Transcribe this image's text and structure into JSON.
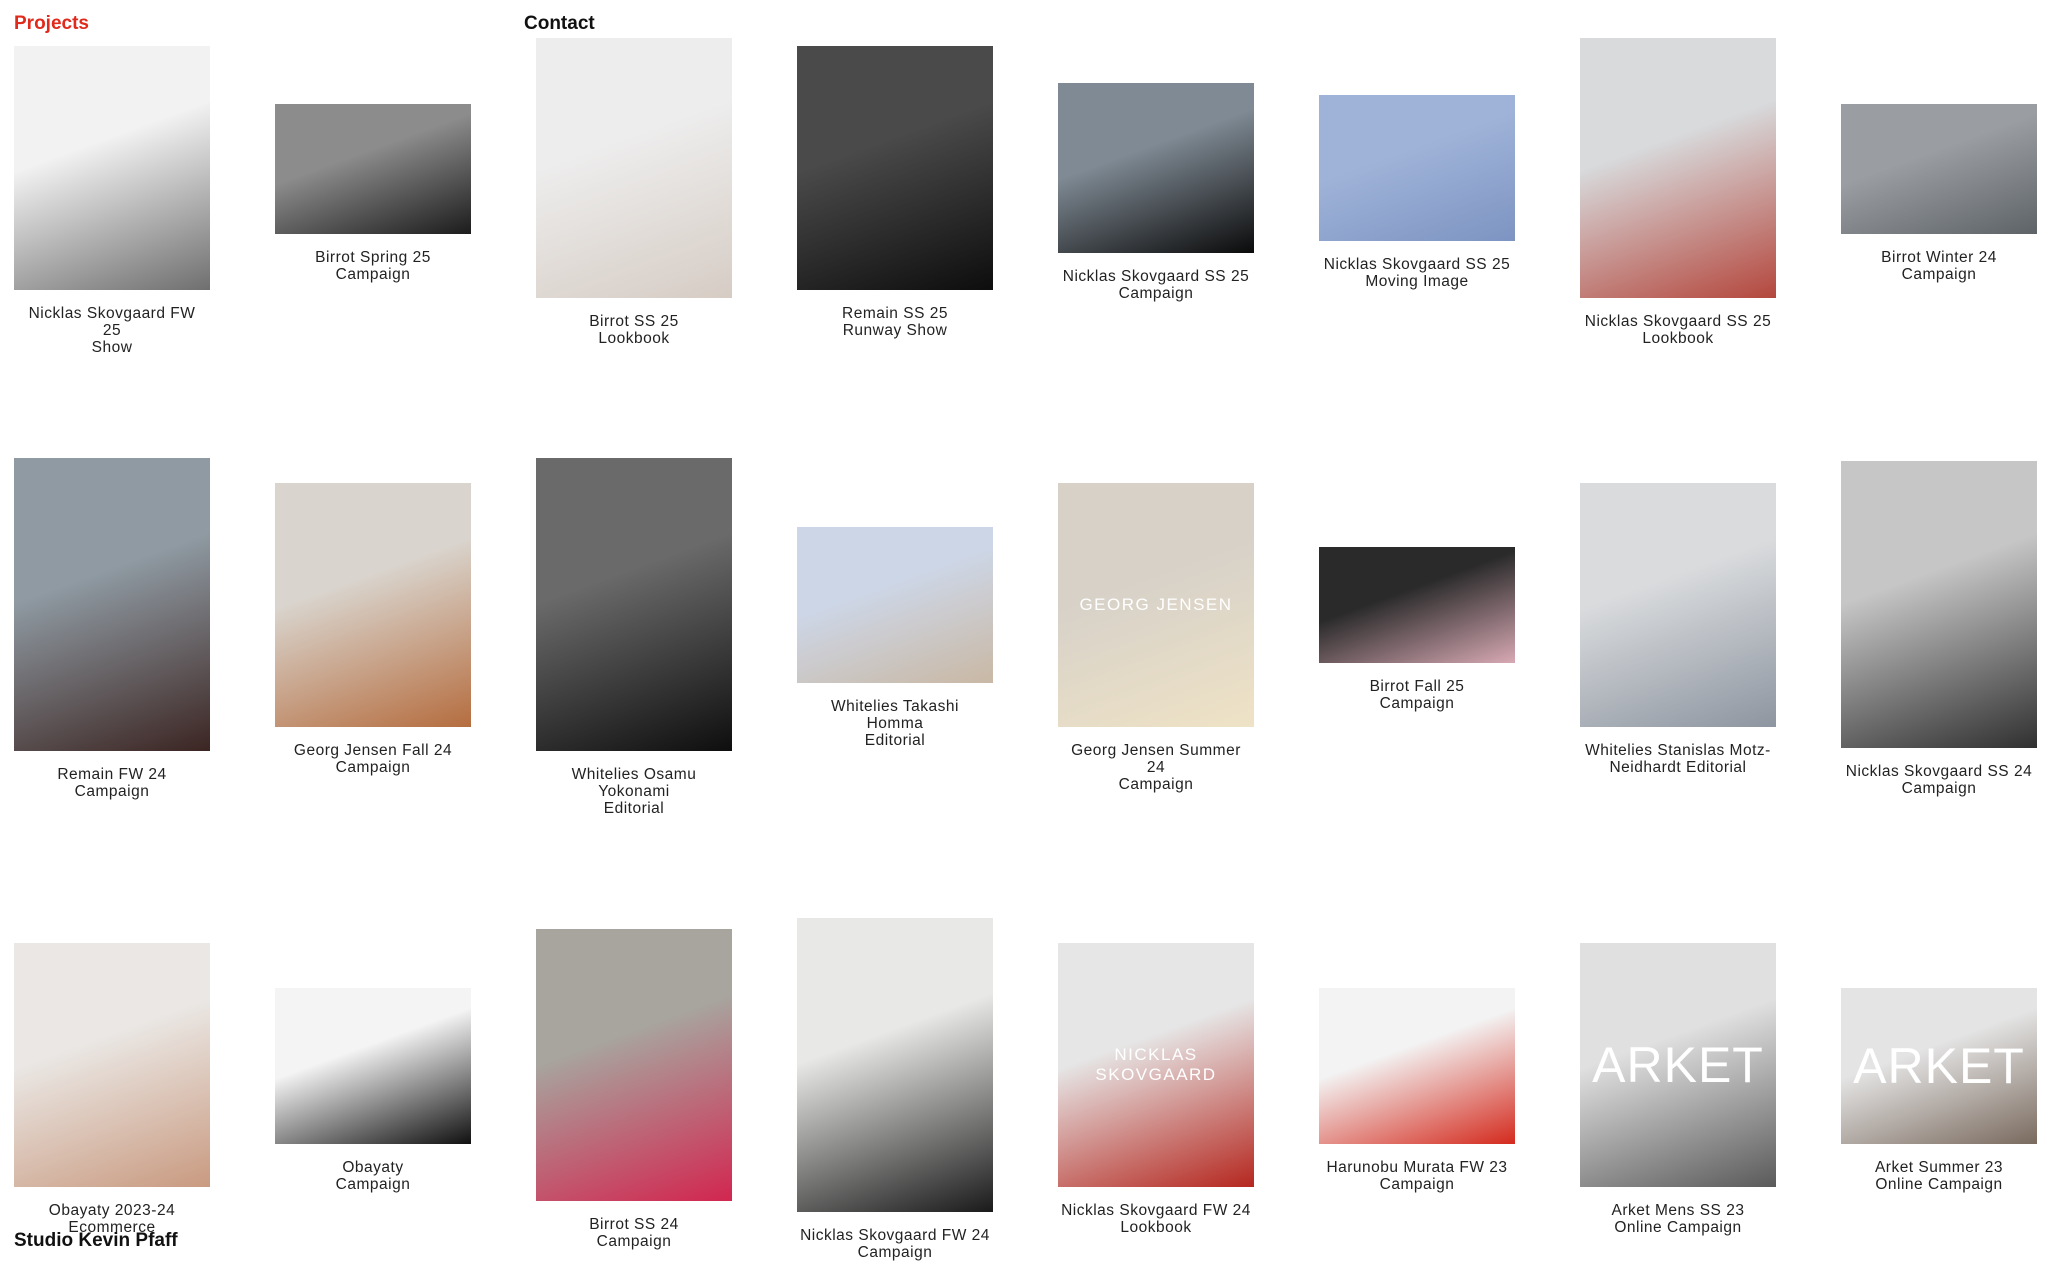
{
  "nav": {
    "projects_label": "Projects",
    "contact_label": "Contact",
    "active_color": "#e02a1b"
  },
  "footer": {
    "studio_name": "Studio Kevin Pfaff"
  },
  "projects": [
    {
      "id": "nicklas-skovgaard-fw25-show",
      "lines": [
        "Nicklas Skovgaard FW",
        "25",
        "Show"
      ],
      "tone": [
        "#f2f2f2",
        "#6f6f6f"
      ],
      "overlay": ""
    },
    {
      "id": "birrot-spring-25-campaign",
      "lines": [
        "Birrot Spring 25",
        "Campaign"
      ],
      "tone": [
        "#8c8c8c",
        "#1c1c1c"
      ],
      "overlay": ""
    },
    {
      "id": "birrot-ss25-lookbook",
      "lines": [
        "Birrot SS 25",
        "Lookbook"
      ],
      "tone": [
        "#ededed",
        "#d6ccc4"
      ],
      "overlay": ""
    },
    {
      "id": "remain-ss25-runway-show",
      "lines": [
        "Remain SS 25",
        "Runway Show"
      ],
      "tone": [
        "#4a4a4a",
        "#0d0d0d"
      ],
      "overlay": ""
    },
    {
      "id": "nicklas-skovgaard-ss25-campaign",
      "lines": [
        "Nicklas Skovgaard SS 25",
        "Campaign"
      ],
      "tone": [
        "#7f8a94",
        "#0a0a0a"
      ],
      "overlay": ""
    },
    {
      "id": "nicklas-skovgaard-ss25-moving-image",
      "lines": [
        "Nicklas Skovgaard SS 25",
        "Moving Image"
      ],
      "tone": [
        "#9fb3d8",
        "#7d94c2"
      ],
      "overlay": ""
    },
    {
      "id": "nicklas-skovgaard-ss25-lookbook",
      "lines": [
        "Nicklas Skovgaard SS 25",
        "Lookbook"
      ],
      "tone": [
        "#d8dadc",
        "#b4473d"
      ],
      "overlay": ""
    },
    {
      "id": "birrot-winter-24-campaign",
      "lines": [
        "Birrot Winter 24",
        "Campaign"
      ],
      "tone": [
        "#9a9ea3",
        "#5e6368"
      ],
      "overlay": ""
    },
    {
      "id": "remain-fw24-campaign",
      "lines": [
        "Remain FW 24",
        "Campaign"
      ],
      "tone": [
        "#8f9aa2",
        "#3b2522"
      ],
      "overlay": ""
    },
    {
      "id": "georg-jensen-fall-24-campaign",
      "lines": [
        "Georg Jensen Fall 24",
        "Campaign"
      ],
      "tone": [
        "#d9d4cd",
        "#b56d3f"
      ],
      "overlay": ""
    },
    {
      "id": "whitelies-osamu-yokonami-editorial",
      "lines": [
        "Whitelies Osamu",
        "Yokonami",
        "Editorial"
      ],
      "tone": [
        "#6a6a6a",
        "#0e0e0e"
      ],
      "overlay": ""
    },
    {
      "id": "whitelies-takashi-homma-editorial",
      "lines": [
        "Whitelies Takashi",
        "Homma",
        "Editorial"
      ],
      "tone": [
        "#cdd6e6",
        "#c9b8a4"
      ],
      "overlay": ""
    },
    {
      "id": "georg-jensen-summer-24-campaign",
      "lines": [
        "Georg Jensen Summer",
        "24",
        "Campaign"
      ],
      "tone": [
        "#d7d1c8",
        "#efe3c6"
      ],
      "overlay": "GEORG JENSEN"
    },
    {
      "id": "birrot-fall-25-campaign",
      "lines": [
        "Birrot Fall 25",
        "Campaign"
      ],
      "tone": [
        "#2a2a2a",
        "#d8a9b4"
      ],
      "overlay": ""
    },
    {
      "id": "whitelies-stanislas-motz-neidhardt-editorial",
      "lines": [
        "Whitelies Stanislas Motz-",
        "Neidhardt Editorial"
      ],
      "tone": [
        "#d9dbdd",
        "#8d95a0"
      ],
      "overlay": ""
    },
    {
      "id": "nicklas-skovgaard-ss24-campaign",
      "lines": [
        "Nicklas Skovgaard SS 24",
        "Campaign"
      ],
      "tone": [
        "#c6c6c6",
        "#303030"
      ],
      "overlay": ""
    },
    {
      "id": "obayaty-2023-24-ecommerce",
      "lines": [
        "Obayaty 2023-24",
        "Ecommerce"
      ],
      "tone": [
        "#eae7e4",
        "#c99a80"
      ],
      "overlay": ""
    },
    {
      "id": "obayaty-campaign",
      "lines": [
        "Obayaty",
        "Campaign"
      ],
      "tone": [
        "#f4f4f4",
        "#101010"
      ],
      "overlay": ""
    },
    {
      "id": "birrot-ss24-campaign",
      "lines": [
        "Birrot SS 24",
        "Campaign"
      ],
      "tone": [
        "#a8a49e",
        "#d2264f"
      ],
      "overlay": ""
    },
    {
      "id": "nicklas-skovgaard-fw24-campaign",
      "lines": [
        "Nicklas Skovgaard FW 24",
        "Campaign"
      ],
      "tone": [
        "#e8e8e6",
        "#1a1a1a"
      ],
      "overlay": ""
    },
    {
      "id": "nicklas-skovgaard-fw24-lookbook",
      "lines": [
        "Nicklas Skovgaard FW 24",
        "Lookbook"
      ],
      "tone": [
        "#e6e6e6",
        "#b5271f"
      ],
      "overlay": "NICKLAS SKOVGAARD"
    },
    {
      "id": "harunobu-murata-fw23-campaign",
      "lines": [
        "Harunobu Murata FW 23",
        "Campaign"
      ],
      "tone": [
        "#f3f3f3",
        "#d42a1d"
      ],
      "overlay": ""
    },
    {
      "id": "arket-mens-ss23-online-campaign",
      "lines": [
        "Arket Mens SS 23",
        "Online Campaign"
      ],
      "tone": [
        "#e0e0e0",
        "#5a5a5a"
      ],
      "overlay": "ARKET"
    },
    {
      "id": "arket-summer-23-online-campaign",
      "lines": [
        "Arket Summer 23",
        "Online Campaign"
      ],
      "tone": [
        "#e4e4e4",
        "#7a6a5e"
      ],
      "overlay": "ARKET"
    }
  ]
}
